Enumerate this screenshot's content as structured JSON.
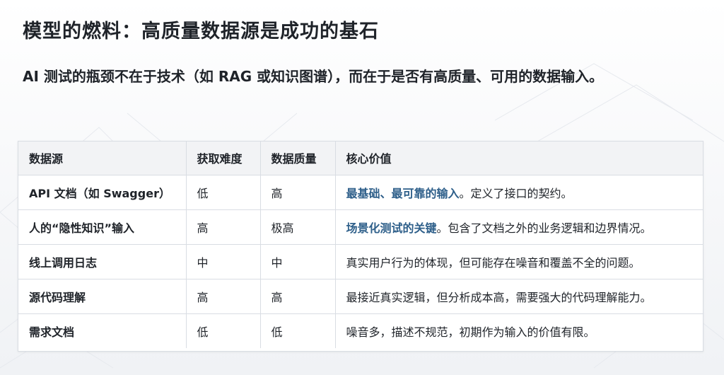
{
  "title": "模型的燃料：高质量数据源是成功的基石",
  "subtitle": "AI 测试的瓶颈不在于技术（如 RAG 或知识图谱），而在于是否有高质量、可用的数据输入。",
  "colors": {
    "highlight": "#2e5f8a",
    "text": "#1f2329",
    "header_bg": "#f2f3f5",
    "border": "#d9dde3"
  },
  "table": {
    "headers": [
      "数据源",
      "获取难度",
      "数据质量",
      "核心价值"
    ],
    "rows": [
      {
        "source": "API 文档（如 Swagger）",
        "difficulty": "低",
        "quality": "高",
        "value_highlight": "最基础、最可靠的输入",
        "value_rest": "。定义了接口的契约。"
      },
      {
        "source": "人的“隐性知识”输入",
        "difficulty": "高",
        "quality": "极高",
        "value_highlight": "场景化测试的关键",
        "value_rest": "。包含了文档之外的业务逻辑和边界情况。"
      },
      {
        "source": "线上调用日志",
        "difficulty": "中",
        "quality": "中",
        "value_highlight": "",
        "value_rest": "真实用户行为的体现，但可能存在噪音和覆盖不全的问题。"
      },
      {
        "source": "源代码理解",
        "difficulty": "高",
        "quality": "高",
        "value_highlight": "",
        "value_rest": "最接近真实逻辑，但分析成本高，需要强大的代码理解能力。"
      },
      {
        "source": "需求文档",
        "difficulty": "低",
        "quality": "低",
        "value_highlight": "",
        "value_rest": "噪音多，描述不规范，初期作为输入的价值有限。"
      }
    ]
  }
}
